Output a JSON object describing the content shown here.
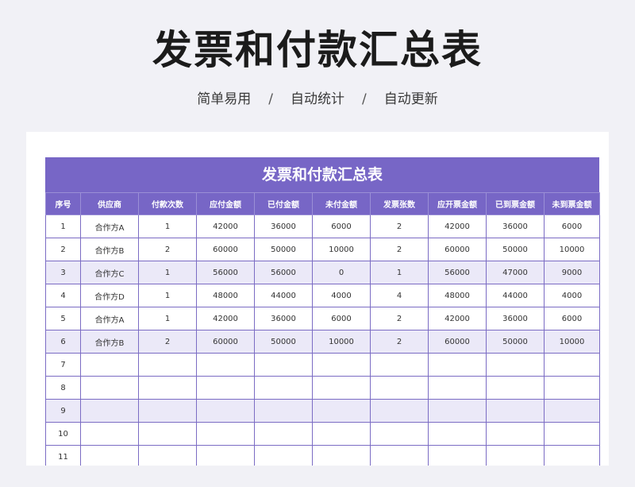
{
  "page": {
    "title": "发票和付款汇总表",
    "subtitle_items": [
      "简单易用",
      "自动统计",
      "自动更新"
    ],
    "separator": "/"
  },
  "sheet": {
    "title": "发票和付款汇总表",
    "headers": [
      "序号",
      "供应商",
      "付款次数",
      "应付金额",
      "已付金额",
      "未付金额",
      "发票张数",
      "应开票金额",
      "已到票金额",
      "未到票金额"
    ],
    "rows": [
      [
        "1",
        "合作方A",
        "1",
        "42000",
        "36000",
        "6000",
        "2",
        "42000",
        "36000",
        "6000"
      ],
      [
        "2",
        "合作方B",
        "2",
        "60000",
        "50000",
        "10000",
        "2",
        "60000",
        "50000",
        "10000"
      ],
      [
        "3",
        "合作方C",
        "1",
        "56000",
        "56000",
        "0",
        "1",
        "56000",
        "47000",
        "9000"
      ],
      [
        "4",
        "合作方D",
        "1",
        "48000",
        "44000",
        "4000",
        "4",
        "48000",
        "44000",
        "4000"
      ],
      [
        "5",
        "合作方A",
        "1",
        "42000",
        "36000",
        "6000",
        "2",
        "42000",
        "36000",
        "6000"
      ],
      [
        "6",
        "合作方B",
        "2",
        "60000",
        "50000",
        "10000",
        "2",
        "60000",
        "50000",
        "10000"
      ],
      [
        "7",
        "",
        "",
        "",
        "",
        "",
        "",
        "",
        "",
        ""
      ],
      [
        "8",
        "",
        "",
        "",
        "",
        "",
        "",
        "",
        "",
        ""
      ],
      [
        "9",
        "",
        "",
        "",
        "",
        "",
        "",
        "",
        "",
        ""
      ],
      [
        "10",
        "",
        "",
        "",
        "",
        "",
        "",
        "",
        "",
        ""
      ],
      [
        "11",
        "",
        "",
        "",
        "",
        "",
        "",
        "",
        "",
        ""
      ]
    ],
    "shaded_rows": [
      2,
      5,
      8
    ]
  },
  "colors": {
    "accent": "#7766c6",
    "shade": "#ebe9f8",
    "border": "#7b6cc4",
    "background": "#f1f1f6"
  }
}
